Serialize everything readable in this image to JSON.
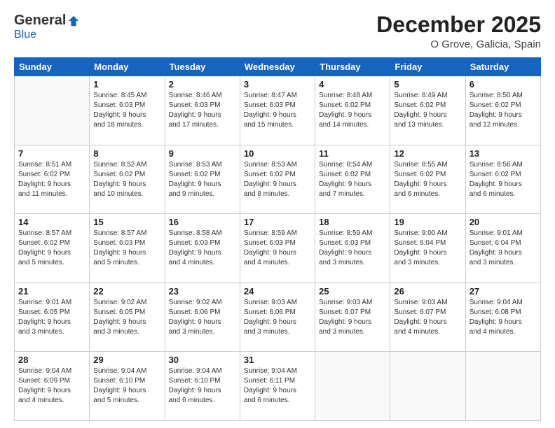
{
  "logo": {
    "general": "General",
    "blue": "Blue"
  },
  "title": "December 2025",
  "location": "O Grove, Galicia, Spain",
  "days_header": [
    "Sunday",
    "Monday",
    "Tuesday",
    "Wednesday",
    "Thursday",
    "Friday",
    "Saturday"
  ],
  "weeks": [
    [
      {
        "day": "",
        "info": ""
      },
      {
        "day": "1",
        "info": "Sunrise: 8:45 AM\nSunset: 6:03 PM\nDaylight: 9 hours\nand 18 minutes."
      },
      {
        "day": "2",
        "info": "Sunrise: 8:46 AM\nSunset: 6:03 PM\nDaylight: 9 hours\nand 17 minutes."
      },
      {
        "day": "3",
        "info": "Sunrise: 8:47 AM\nSunset: 6:03 PM\nDaylight: 9 hours\nand 15 minutes."
      },
      {
        "day": "4",
        "info": "Sunrise: 8:48 AM\nSunset: 6:02 PM\nDaylight: 9 hours\nand 14 minutes."
      },
      {
        "day": "5",
        "info": "Sunrise: 8:49 AM\nSunset: 6:02 PM\nDaylight: 9 hours\nand 13 minutes."
      },
      {
        "day": "6",
        "info": "Sunrise: 8:50 AM\nSunset: 6:02 PM\nDaylight: 9 hours\nand 12 minutes."
      }
    ],
    [
      {
        "day": "7",
        "info": "Sunrise: 8:51 AM\nSunset: 6:02 PM\nDaylight: 9 hours\nand 11 minutes."
      },
      {
        "day": "8",
        "info": "Sunrise: 8:52 AM\nSunset: 6:02 PM\nDaylight: 9 hours\nand 10 minutes."
      },
      {
        "day": "9",
        "info": "Sunrise: 8:53 AM\nSunset: 6:02 PM\nDaylight: 9 hours\nand 9 minutes."
      },
      {
        "day": "10",
        "info": "Sunrise: 8:53 AM\nSunset: 6:02 PM\nDaylight: 9 hours\nand 8 minutes."
      },
      {
        "day": "11",
        "info": "Sunrise: 8:54 AM\nSunset: 6:02 PM\nDaylight: 9 hours\nand 7 minutes."
      },
      {
        "day": "12",
        "info": "Sunrise: 8:55 AM\nSunset: 6:02 PM\nDaylight: 9 hours\nand 6 minutes."
      },
      {
        "day": "13",
        "info": "Sunrise: 8:56 AM\nSunset: 6:02 PM\nDaylight: 9 hours\nand 6 minutes."
      }
    ],
    [
      {
        "day": "14",
        "info": "Sunrise: 8:57 AM\nSunset: 6:02 PM\nDaylight: 9 hours\nand 5 minutes."
      },
      {
        "day": "15",
        "info": "Sunrise: 8:57 AM\nSunset: 6:03 PM\nDaylight: 9 hours\nand 5 minutes."
      },
      {
        "day": "16",
        "info": "Sunrise: 8:58 AM\nSunset: 6:03 PM\nDaylight: 9 hours\nand 4 minutes."
      },
      {
        "day": "17",
        "info": "Sunrise: 8:59 AM\nSunset: 6:03 PM\nDaylight: 9 hours\nand 4 minutes."
      },
      {
        "day": "18",
        "info": "Sunrise: 8:59 AM\nSunset: 6:03 PM\nDaylight: 9 hours\nand 3 minutes."
      },
      {
        "day": "19",
        "info": "Sunrise: 9:00 AM\nSunset: 6:04 PM\nDaylight: 9 hours\nand 3 minutes."
      },
      {
        "day": "20",
        "info": "Sunrise: 9:01 AM\nSunset: 6:04 PM\nDaylight: 9 hours\nand 3 minutes."
      }
    ],
    [
      {
        "day": "21",
        "info": "Sunrise: 9:01 AM\nSunset: 6:05 PM\nDaylight: 9 hours\nand 3 minutes."
      },
      {
        "day": "22",
        "info": "Sunrise: 9:02 AM\nSunset: 6:05 PM\nDaylight: 9 hours\nand 3 minutes."
      },
      {
        "day": "23",
        "info": "Sunrise: 9:02 AM\nSunset: 6:06 PM\nDaylight: 9 hours\nand 3 minutes."
      },
      {
        "day": "24",
        "info": "Sunrise: 9:03 AM\nSunset: 6:06 PM\nDaylight: 9 hours\nand 3 minutes."
      },
      {
        "day": "25",
        "info": "Sunrise: 9:03 AM\nSunset: 6:07 PM\nDaylight: 9 hours\nand 3 minutes."
      },
      {
        "day": "26",
        "info": "Sunrise: 9:03 AM\nSunset: 6:07 PM\nDaylight: 9 hours\nand 4 minutes."
      },
      {
        "day": "27",
        "info": "Sunrise: 9:04 AM\nSunset: 6:08 PM\nDaylight: 9 hours\nand 4 minutes."
      }
    ],
    [
      {
        "day": "28",
        "info": "Sunrise: 9:04 AM\nSunset: 6:09 PM\nDaylight: 9 hours\nand 4 minutes."
      },
      {
        "day": "29",
        "info": "Sunrise: 9:04 AM\nSunset: 6:10 PM\nDaylight: 9 hours\nand 5 minutes."
      },
      {
        "day": "30",
        "info": "Sunrise: 9:04 AM\nSunset: 6:10 PM\nDaylight: 9 hours\nand 6 minutes."
      },
      {
        "day": "31",
        "info": "Sunrise: 9:04 AM\nSunset: 6:11 PM\nDaylight: 9 hours\nand 6 minutes."
      },
      {
        "day": "",
        "info": ""
      },
      {
        "day": "",
        "info": ""
      },
      {
        "day": "",
        "info": ""
      }
    ]
  ]
}
